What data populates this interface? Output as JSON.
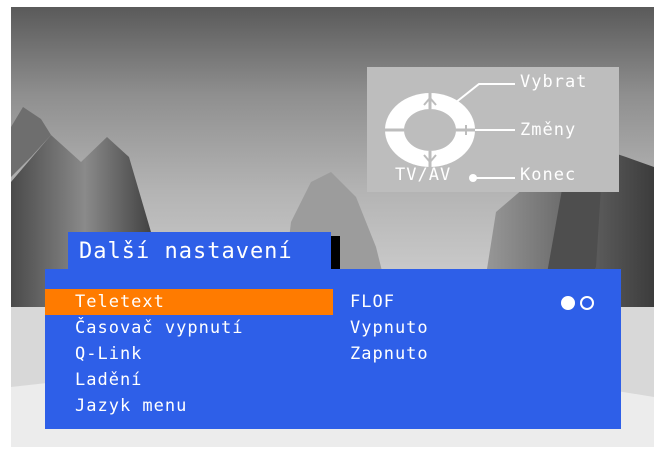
{
  "help": {
    "select_label": "Vybrat",
    "change_label": "Změny",
    "exit_label": "Konec",
    "tvav_label": "TV/AV",
    "icon": "remote-dpad-icon"
  },
  "menu": {
    "title": "Další nastavení",
    "items": [
      {
        "label": "Teletext",
        "selected": true
      },
      {
        "label": "Časovač vypnutí",
        "selected": false
      },
      {
        "label": "Q-Link",
        "selected": false
      },
      {
        "label": "Ladění",
        "selected": false
      },
      {
        "label": "Jazyk menu",
        "selected": false
      }
    ],
    "options": [
      "FLOF",
      "Vypnuto",
      "Zapnuto"
    ],
    "page_dots": {
      "current": 1,
      "total": 2
    }
  },
  "colors": {
    "panel": "#2e5fe8",
    "highlight": "#ff7b00",
    "text": "#ffffff",
    "help_box": "#bdbdbd"
  }
}
